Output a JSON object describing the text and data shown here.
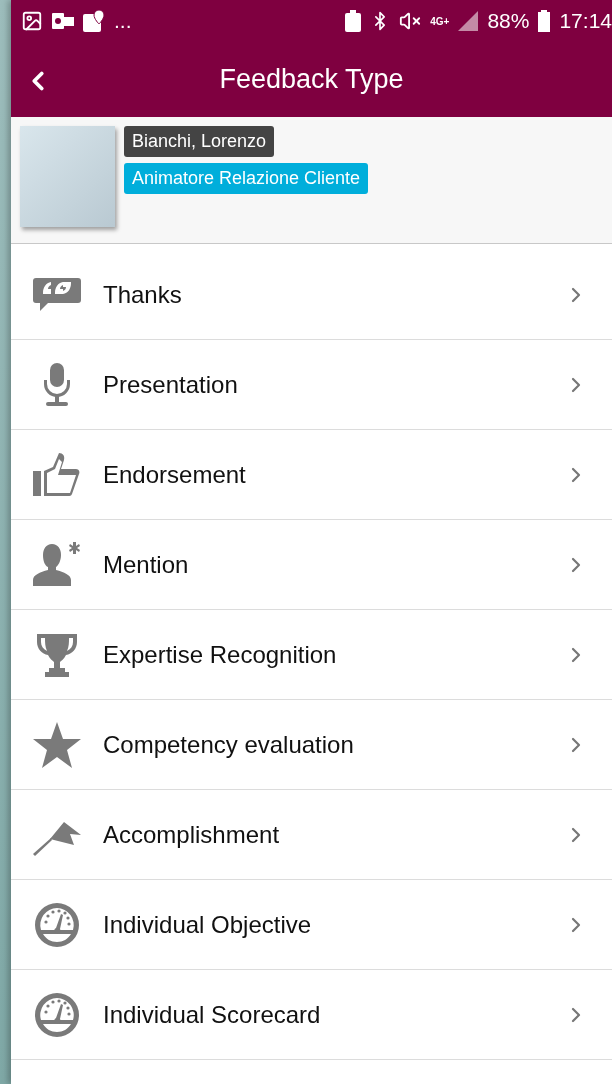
{
  "status_bar": {
    "more": "...",
    "network": "4G+",
    "battery": "88%",
    "time": "17:14"
  },
  "app_bar": {
    "title": "Feedback Type"
  },
  "profile": {
    "name": "Bianchi, Lorenzo",
    "role": "Animatore Relazione Cliente"
  },
  "feedback_types": [
    {
      "label": "Thanks",
      "kind": "quote"
    },
    {
      "label": "Presentation",
      "kind": "microphone"
    },
    {
      "label": "Endorsement",
      "kind": "thumb"
    },
    {
      "label": "Mention",
      "kind": "person"
    },
    {
      "label": "Expertise Recognition",
      "kind": "trophy"
    },
    {
      "label": "Competency evaluation",
      "kind": "star"
    },
    {
      "label": "Accomplishment",
      "kind": "flag"
    },
    {
      "label": "Individual Objective",
      "kind": "gauge"
    },
    {
      "label": "Individual Scorecard",
      "kind": "gauge"
    }
  ]
}
